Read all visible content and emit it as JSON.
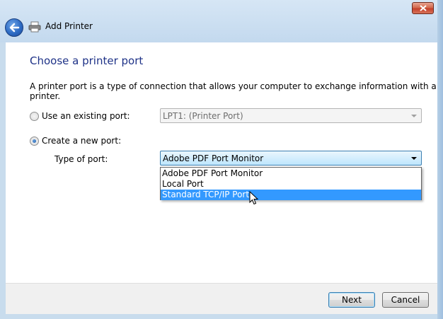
{
  "window": {
    "title": "Add Printer"
  },
  "page": {
    "heading": "Choose a printer port",
    "description": "A printer port is a type of connection that allows your computer to exchange information with a printer."
  },
  "existing_port": {
    "label": "Use an existing port:",
    "value": "LPT1: (Printer Port)"
  },
  "new_port": {
    "label": "Create a new port:",
    "type_label": "Type of port:",
    "value": "Adobe PDF Port Monitor"
  },
  "dropdown": {
    "options": [
      "Adobe PDF Port Monitor",
      "Local Port",
      "Standard TCP/IP Port"
    ],
    "highlighted": "Standard TCP/IP Port"
  },
  "buttons": {
    "next": "Next",
    "cancel": "Cancel"
  },
  "icons": {
    "back": "back-arrow-icon",
    "printer": "printer-icon",
    "close": "close-icon",
    "cursor": "mouse-pointer-icon"
  }
}
